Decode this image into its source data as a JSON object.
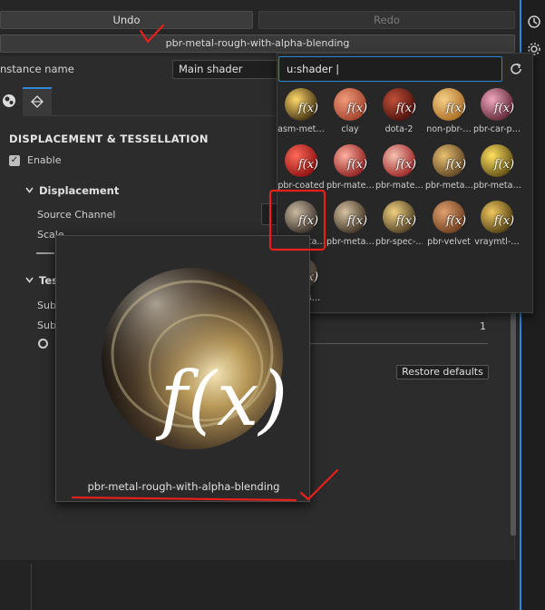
{
  "toolbar": {
    "undo_label": "Undo",
    "redo_label": "Redo"
  },
  "material": {
    "name": "pbr-metal-rough-with-alpha-blending"
  },
  "panel": {
    "instance_name_label": "nstance name",
    "instance_name_value": "Main shader",
    "section_title": "DISPLACEMENT & TESSELLATION",
    "enable_label": "Enable",
    "displacement_title": "Displacement",
    "source_channel_label": "Source Channel",
    "scale_label": "Scale",
    "tess_title": "Tes",
    "sub_label_1": "Subd",
    "sub_label_2": "Subd",
    "value_one": "1",
    "restore_label": "Restore defaults"
  },
  "shader_browser": {
    "search_value": "u:shader |",
    "items": [
      {
        "label": "asm-met…",
        "color_a": "#ffd86a",
        "color_b": "#3a2a10"
      },
      {
        "label": "clay",
        "color_a": "#f29a7a",
        "color_b": "#a0402a"
      },
      {
        "label": "dota-2",
        "color_a": "#c0503a",
        "color_b": "#4a0f0a"
      },
      {
        "label": "non-pbr-…",
        "color_a": "#f7d088",
        "color_b": "#a86a22"
      },
      {
        "label": "pbr-car-p…",
        "color_a": "#f2a8c0",
        "color_b": "#5a2230"
      },
      {
        "label": "pbr-coated",
        "color_a": "#ff6a5a",
        "color_b": "#8a0e0e"
      },
      {
        "label": "pbr-mate…",
        "color_a": "#ffb0a0",
        "color_b": "#8a1a1a"
      },
      {
        "label": "pbr-mate…",
        "color_a": "#f5c0b0",
        "color_b": "#9a2020"
      },
      {
        "label": "pbr-meta…",
        "color_a": "#e8c070",
        "color_b": "#5a4020"
      },
      {
        "label": "pbr-meta…",
        "color_a": "#ffe060",
        "color_b": "#5a4a10"
      },
      {
        "label": "pbr-meta…",
        "color_a": "#c8b8a0",
        "color_b": "#3a3028"
      },
      {
        "label": "pbr-meta…",
        "color_a": "#d6c0a0",
        "color_b": "#3a2e20"
      },
      {
        "label": "pbr-spec-…",
        "color_a": "#f0d080",
        "color_b": "#4a3a20"
      },
      {
        "label": "pbr-velvet",
        "color_a": "#e0a070",
        "color_b": "#6a3a1a"
      },
      {
        "label": "vraymtl-…",
        "color_a": "#f0c860",
        "color_b": "#4a3a10"
      },
      {
        "label": "pbr-ms…",
        "color_a": "#c8b8a0",
        "color_b": "#3a3028"
      }
    ]
  },
  "preview": {
    "name": "pbr-metal-rough-with-alpha-blending",
    "fx_symbol": "f(x)",
    "fx_small": "f(x)"
  },
  "colors": {
    "accent": "#2f86d6",
    "annotation": "#e8201a"
  },
  "icons": [
    "history-icon",
    "gear-icon",
    "refresh-icon",
    "material-tab-icon",
    "geometry-tab-icon",
    "chevron-down-icon",
    "function-icon"
  ]
}
